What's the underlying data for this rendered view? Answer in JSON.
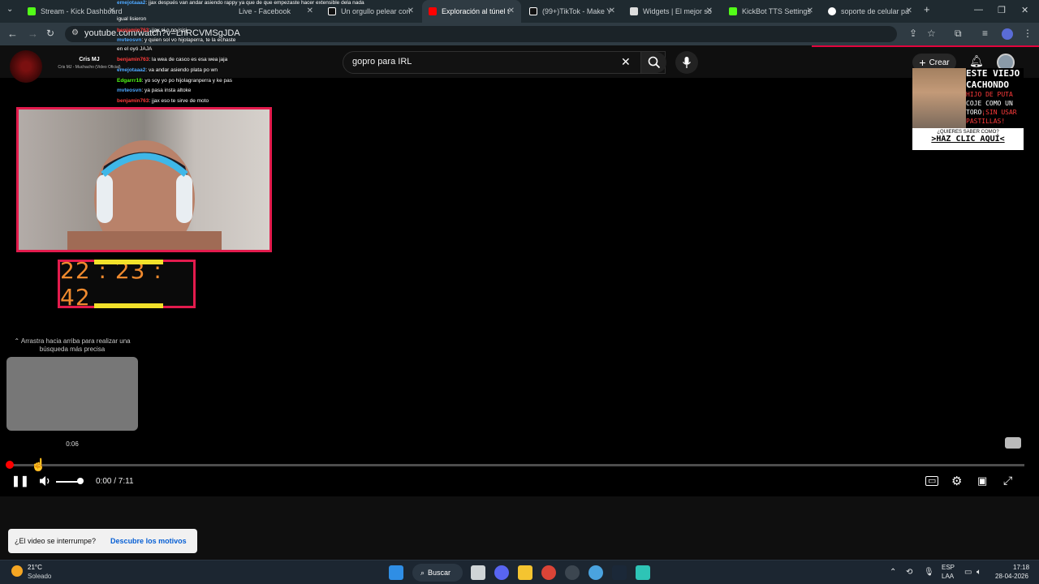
{
  "browser": {
    "tabs": [
      {
        "label": "Stream - Kick Dashboard",
        "color": "#53fc18"
      },
      {
        "label": "Live - Facebook",
        "color": "#1877f2"
      },
      {
        "label": "Un orgullo pelear con",
        "color": "#000000"
      },
      {
        "label": "Exploración al túnel t",
        "color": "#ff0000"
      },
      {
        "label": "(99+)TikTok - Make Y",
        "color": "#000000"
      },
      {
        "label": "Widgets | El mejor so",
        "color": "#444444"
      },
      {
        "label": "KickBot TTS Settings",
        "color": "#53fc18"
      },
      {
        "label": "soporte de celular pa",
        "color": "#4285f4"
      }
    ],
    "new_tab": "+",
    "address": "youtube.com/watch?v=LnRCVMSgJDA"
  },
  "youtube": {
    "search_value": "gopro para IRL",
    "create_label": "Crear",
    "accent": "#ff0000"
  },
  "stream_overlay": {
    "streamer_name": "Cris MJ",
    "streamer_sub": "Cris MJ - Muchacho (Video Oficial)",
    "chat": [
      {
        "user": "emejotaaa2",
        "msg": ": jjax después van andar asiendo rappy ya que de que empezaste hacer extensible dela nada",
        "line2": "igual lisieron",
        "color": "#4ea8ff"
      },
      {
        "user": "benjamin763",
        "msg": ": jjax si o no jsjsj",
        "color": "#ff3b3b"
      },
      {
        "user": "mvteosvn",
        "msg": ": y quien sol vo hijolaperra, te la echaste",
        "line2": "en el oyó JAJA",
        "color": "#4ea8ff"
      },
      {
        "user": "benjamin763",
        "msg": ": la wea de casco es esa wea jaja",
        "color": "#ff3b3b"
      },
      {
        "user": "emejotaaa2",
        "msg": ": va andar asiendo plata po wn",
        "color": "#4ea8ff"
      },
      {
        "user": "Edgarrr18",
        "msg": ": yo soy yo po hijolagranperra y ke pas",
        "color": "#53fc18"
      },
      {
        "user": "mvteosvn",
        "msg": ": ya pasa insta altoke",
        "color": "#4ea8ff"
      },
      {
        "user": "benjamin763",
        "msg": ": jjax eso te sirve de moto",
        "color": "#ff3b3b"
      }
    ],
    "timer": "22 : 23 : 42"
  },
  "ad": {
    "line1": "ESTE VIEJO",
    "line2": "CACHONDO",
    "line3": "HIJO DE PUTA",
    "line4": "COJE COMO UN",
    "line5": "TORO",
    "line5b": "¡SIN USAR",
    "line6": "PASTILLAS!",
    "question": "¿QUIERES SABER COMO?",
    "cta": ">HAZ CLIC AQUÍ<"
  },
  "player": {
    "drag_hint": "Arrastra hacia arriba para realizar una búsqueda más precisa",
    "preview_time": "0:06",
    "current_time": "0:00",
    "duration": "7:11",
    "time_display": "0:00 / 7:11",
    "progress_fraction": 0.003,
    "volume_fraction": 1.0
  },
  "toast": {
    "text": "¿El video se interrumpe?",
    "link": "Descubre los motivos"
  },
  "taskbar": {
    "weather_temp": "21°C",
    "weather_desc": "Soleado",
    "search_label": "Buscar",
    "lang": "ESP",
    "lang2": "LAA",
    "time": "17:18",
    "date": "28-04-2026"
  }
}
